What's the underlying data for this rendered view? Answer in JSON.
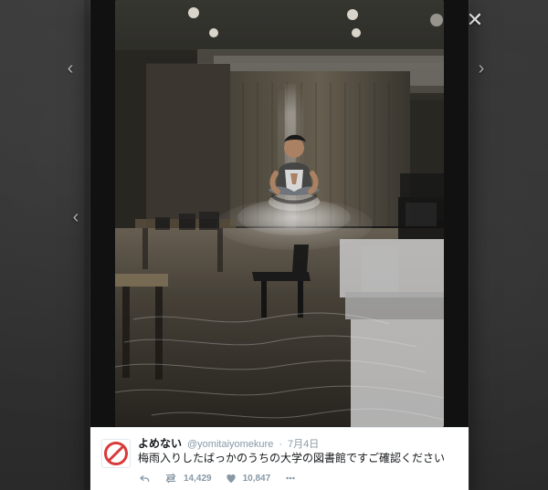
{
  "ui": {
    "close_symbol": "✕",
    "nav_prev_symbol": "‹",
    "nav_next_symbol": "›"
  },
  "tweet": {
    "name": "よめない",
    "handle": "@yomitaiyomekure",
    "separator": "·",
    "date": "7月4日",
    "text": "梅雨入りしたばっかのうちの大学の図書館ですご確認ください",
    "counts": {
      "retweets": "14,429",
      "likes": "10,847"
    }
  },
  "icons": {
    "close": "close-icon",
    "nav_prev": "chevron-left-icon",
    "nav_next": "chevron-right-icon",
    "avatar": "no-symbol-icon",
    "reply": "reply-icon",
    "retweet": "retweet-icon",
    "like": "heart-icon",
    "more": "more-icon"
  },
  "colors": {
    "card_bg": "#ffffff",
    "text_primary": "#14171a",
    "text_secondary": "#8899a6",
    "avatar_red": "#d93a3a"
  }
}
